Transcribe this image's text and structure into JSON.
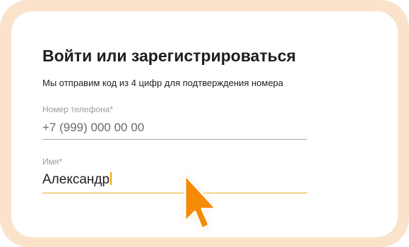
{
  "form": {
    "title": "Войти или зарегистрироваться",
    "subtitle": "Мы отправим код из 4 цифр для подтверждения номера",
    "phone": {
      "label": "Номер телефона*",
      "value": "+7 (999) 000 00 00"
    },
    "name": {
      "label": "Имя*",
      "value": "Александр"
    }
  },
  "colors": {
    "frame": "#fbe3cb",
    "accent": "#f58a07",
    "active_underline": "#e8b020"
  },
  "icons": {
    "pointer": "pointer-cursor-icon"
  }
}
